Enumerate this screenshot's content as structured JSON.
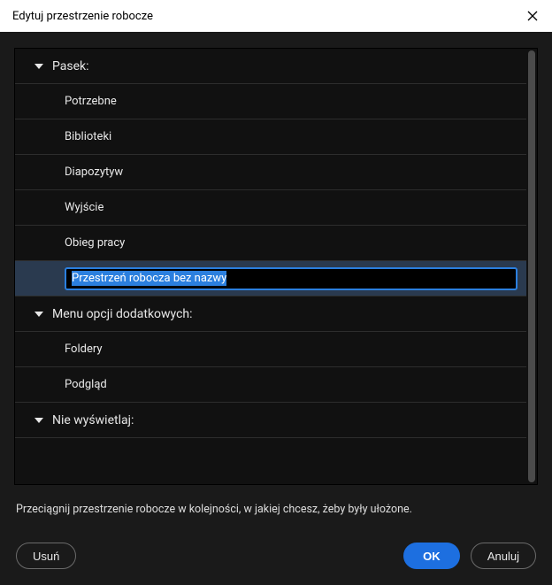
{
  "titlebar": {
    "title": "Edytuj przestrzenie robocze"
  },
  "sections": {
    "group0": {
      "label": "Pasek:",
      "items": [
        "Potrzebne",
        "Biblioteki",
        "Diapozytyw",
        "Wyjście",
        "Obieg pracy"
      ]
    },
    "editing_value": "Przestrzeń robocza bez nazwy",
    "group1": {
      "label": "Menu opcji dodatkowych:",
      "items": [
        "Foldery",
        "Podgląd"
      ]
    },
    "group2": {
      "label": "Nie wyświetlaj:"
    }
  },
  "hint": "Przeciągnij przestrzenie robocze w kolejności, w jakiej chcesz, żeby były ułożone.",
  "footer": {
    "delete": "Usuń",
    "ok": "OK",
    "cancel": "Anuluj"
  }
}
